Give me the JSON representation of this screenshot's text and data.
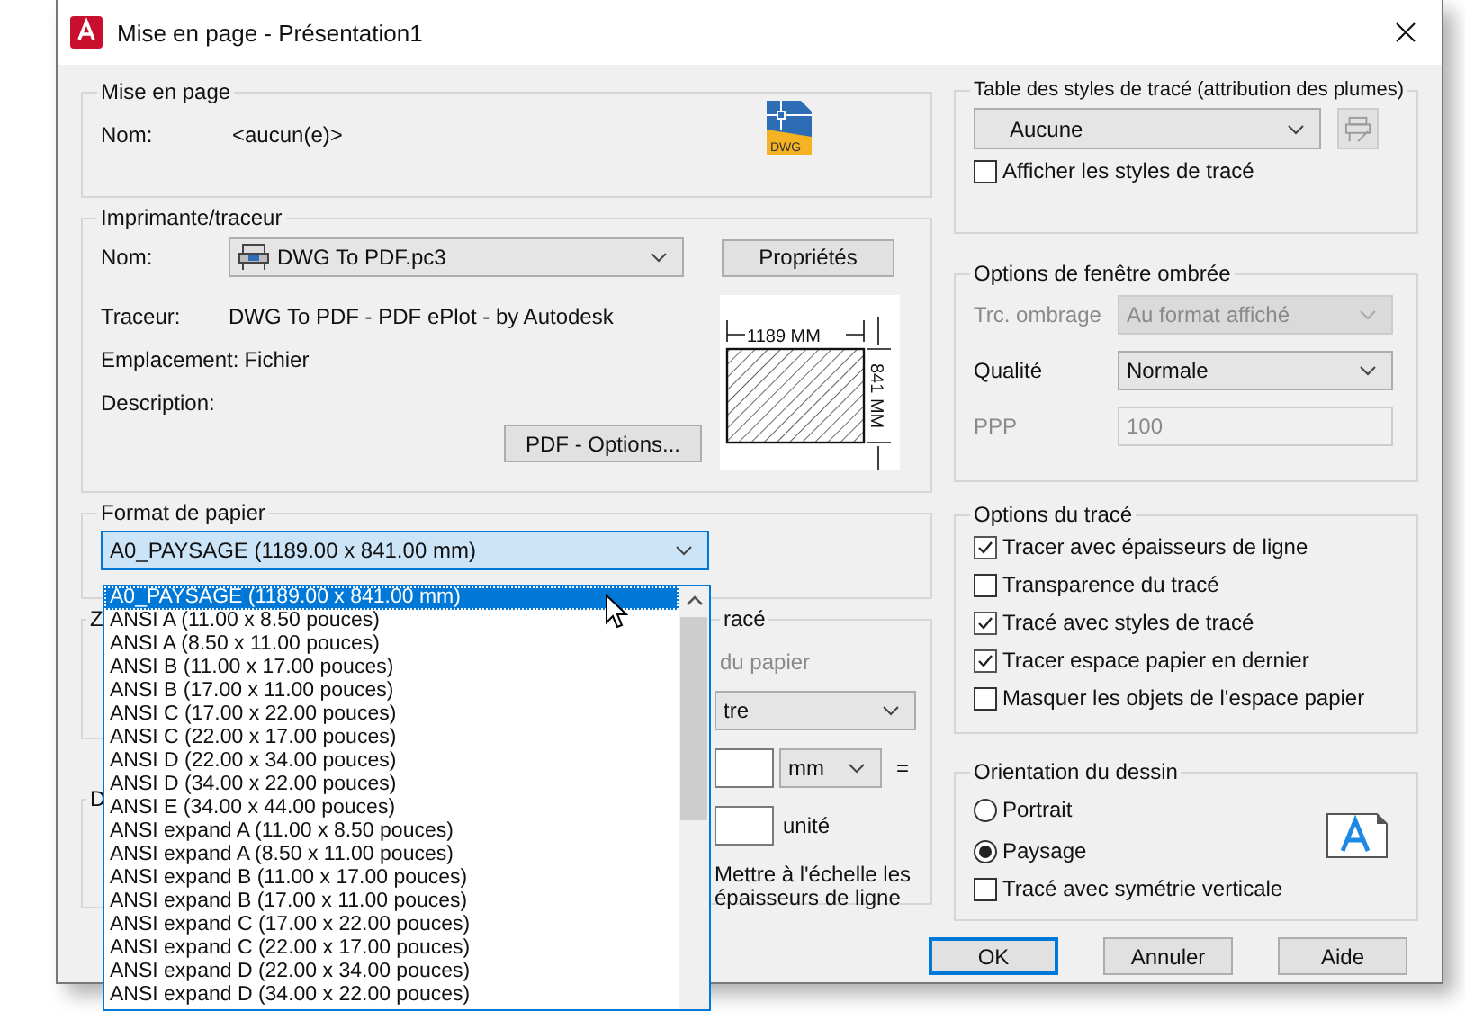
{
  "window": {
    "title": "Mise en page - Présentation1"
  },
  "page_setup": {
    "title": "Mise en page",
    "name_label": "Nom:",
    "name_value": "<aucun(e)>",
    "icon_label": "DWG"
  },
  "printer": {
    "title": "Imprimante/traceur",
    "name_label": "Nom:",
    "name_value": "DWG To PDF.pc3",
    "properties_button": "Propriétés",
    "plotter_label": "Traceur:",
    "plotter_value": "DWG To PDF - PDF ePlot - by Autodesk",
    "location_label": "Emplacement:",
    "location_value": "Fichier",
    "description_label": "Description:",
    "options_button": "PDF - Options...",
    "preview": {
      "width_label": "1189  MM",
      "height_label": "841  MM"
    }
  },
  "paper_size": {
    "title": "Format de papier",
    "value": "A0_PAYSAGE (1189.00 x 841.00 mm)",
    "expanded": true,
    "options": [
      {
        "label": "A0_PAYSAGE (1189.00 x 841.00 mm)",
        "selected": true
      },
      {
        "label": "ANSI A (11.00 x 8.50 pouces)",
        "selected": false
      },
      {
        "label": "ANSI A (8.50 x 11.00 pouces)",
        "selected": false
      },
      {
        "label": "ANSI B (11.00 x 17.00 pouces)",
        "selected": false
      },
      {
        "label": "ANSI B (17.00 x 11.00 pouces)",
        "selected": false
      },
      {
        "label": "ANSI C (17.00 x 22.00 pouces)",
        "selected": false
      },
      {
        "label": "ANSI C (22.00 x 17.00 pouces)",
        "selected": false
      },
      {
        "label": "ANSI D (22.00 x 34.00 pouces)",
        "selected": false
      },
      {
        "label": "ANSI D (34.00 x 22.00 pouces)",
        "selected": false
      },
      {
        "label": "ANSI E (34.00 x 44.00 pouces)",
        "selected": false
      },
      {
        "label": "ANSI expand A (11.00 x 8.50 pouces)",
        "selected": false
      },
      {
        "label": "ANSI expand A (8.50 x 11.00 pouces)",
        "selected": false
      },
      {
        "label": "ANSI expand B (11.00 x 17.00 pouces)",
        "selected": false
      },
      {
        "label": "ANSI expand B (17.00 x 11.00 pouces)",
        "selected": false
      },
      {
        "label": "ANSI expand C (17.00 x 22.00 pouces)",
        "selected": false
      },
      {
        "label": "ANSI expand C (22.00 x 17.00 pouces)",
        "selected": false
      },
      {
        "label": "ANSI expand D (22.00 x 34.00 pouces)",
        "selected": false
      },
      {
        "label": "ANSI expand D (34.00 x 22.00 pouces)",
        "selected": false
      }
    ]
  },
  "covered_groups": [
    {
      "title_fragment": "Z"
    },
    {
      "title_fragment": "D"
    }
  ],
  "plot_scale": {
    "title_fragment": "racé",
    "fit_label": "du papier",
    "fit_disabled": true,
    "scale_value": "tre",
    "unit_value": "mm",
    "equals": "=",
    "unit_label": "unité",
    "lineweights_label": "Mettre à l'échelle les épaisseurs de ligne"
  },
  "plot_style_table": {
    "title": "Table des styles de tracé (attribution des plumes)",
    "value": "Aucune",
    "edit_disabled": true,
    "display_styles": {
      "label": "Afficher les styles de tracé",
      "checked": false
    }
  },
  "shaded_viewport": {
    "title": "Options de fenêtre ombrée",
    "fields": [
      {
        "label": "Trc. ombrage",
        "value": "Au format affiché",
        "kind": "select",
        "disabled": true
      },
      {
        "label": "Qualité",
        "value": "Normale",
        "kind": "select",
        "disabled": false
      },
      {
        "label": "PPP",
        "value": "100",
        "kind": "input",
        "disabled": true
      }
    ]
  },
  "plot_options": {
    "title": "Options du tracé",
    "items": [
      {
        "label": "Tracer avec épaisseurs de ligne",
        "checked": true
      },
      {
        "label": "Transparence du tracé",
        "checked": false
      },
      {
        "label": "Tracé avec styles de tracé",
        "checked": true
      },
      {
        "label": "Tracer espace papier en dernier",
        "checked": true
      },
      {
        "label": "Masquer les objets de l'espace papier",
        "checked": false
      }
    ]
  },
  "orientation": {
    "title": "Orientation du dessin",
    "options": [
      {
        "label": "Portrait",
        "selected": false
      },
      {
        "label": "Paysage",
        "selected": true
      }
    ],
    "upside_down": {
      "label": "Tracé avec symétrie verticale",
      "checked": false
    }
  },
  "buttons": [
    {
      "label": "OK",
      "default": true
    },
    {
      "label": "Annuler",
      "default": false
    },
    {
      "label": "Aide",
      "default": false
    }
  ]
}
